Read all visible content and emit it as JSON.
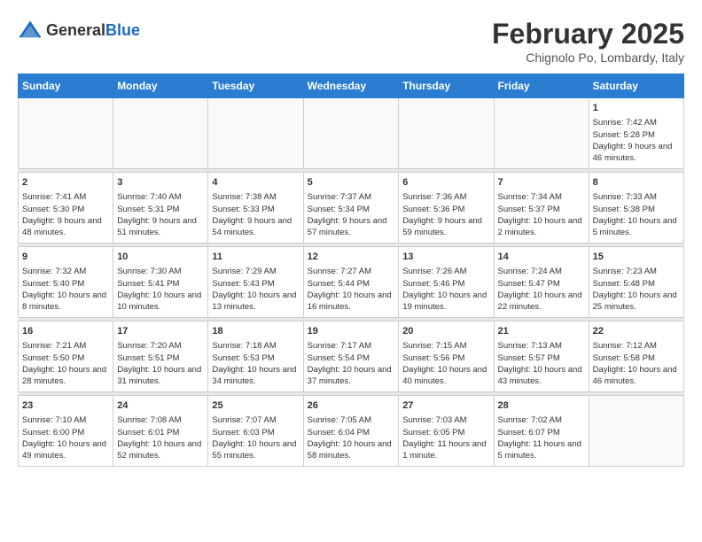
{
  "header": {
    "logo_general": "General",
    "logo_blue": "Blue",
    "title": "February 2025",
    "subtitle": "Chignolo Po, Lombardy, Italy"
  },
  "calendar": {
    "days_of_week": [
      "Sunday",
      "Monday",
      "Tuesday",
      "Wednesday",
      "Thursday",
      "Friday",
      "Saturday"
    ],
    "weeks": [
      {
        "days": [
          {
            "date": "",
            "info": ""
          },
          {
            "date": "",
            "info": ""
          },
          {
            "date": "",
            "info": ""
          },
          {
            "date": "",
            "info": ""
          },
          {
            "date": "",
            "info": ""
          },
          {
            "date": "",
            "info": ""
          },
          {
            "date": "1",
            "info": "Sunrise: 7:42 AM\nSunset: 5:28 PM\nDaylight: 9 hours and 46 minutes."
          }
        ]
      },
      {
        "days": [
          {
            "date": "2",
            "info": "Sunrise: 7:41 AM\nSunset: 5:30 PM\nDaylight: 9 hours and 48 minutes."
          },
          {
            "date": "3",
            "info": "Sunrise: 7:40 AM\nSunset: 5:31 PM\nDaylight: 9 hours and 51 minutes."
          },
          {
            "date": "4",
            "info": "Sunrise: 7:38 AM\nSunset: 5:33 PM\nDaylight: 9 hours and 54 minutes."
          },
          {
            "date": "5",
            "info": "Sunrise: 7:37 AM\nSunset: 5:34 PM\nDaylight: 9 hours and 57 minutes."
          },
          {
            "date": "6",
            "info": "Sunrise: 7:36 AM\nSunset: 5:36 PM\nDaylight: 9 hours and 59 minutes."
          },
          {
            "date": "7",
            "info": "Sunrise: 7:34 AM\nSunset: 5:37 PM\nDaylight: 10 hours and 2 minutes."
          },
          {
            "date": "8",
            "info": "Sunrise: 7:33 AM\nSunset: 5:38 PM\nDaylight: 10 hours and 5 minutes."
          }
        ]
      },
      {
        "days": [
          {
            "date": "9",
            "info": "Sunrise: 7:32 AM\nSunset: 5:40 PM\nDaylight: 10 hours and 8 minutes."
          },
          {
            "date": "10",
            "info": "Sunrise: 7:30 AM\nSunset: 5:41 PM\nDaylight: 10 hours and 10 minutes."
          },
          {
            "date": "11",
            "info": "Sunrise: 7:29 AM\nSunset: 5:43 PM\nDaylight: 10 hours and 13 minutes."
          },
          {
            "date": "12",
            "info": "Sunrise: 7:27 AM\nSunset: 5:44 PM\nDaylight: 10 hours and 16 minutes."
          },
          {
            "date": "13",
            "info": "Sunrise: 7:26 AM\nSunset: 5:46 PM\nDaylight: 10 hours and 19 minutes."
          },
          {
            "date": "14",
            "info": "Sunrise: 7:24 AM\nSunset: 5:47 PM\nDaylight: 10 hours and 22 minutes."
          },
          {
            "date": "15",
            "info": "Sunrise: 7:23 AM\nSunset: 5:48 PM\nDaylight: 10 hours and 25 minutes."
          }
        ]
      },
      {
        "days": [
          {
            "date": "16",
            "info": "Sunrise: 7:21 AM\nSunset: 5:50 PM\nDaylight: 10 hours and 28 minutes."
          },
          {
            "date": "17",
            "info": "Sunrise: 7:20 AM\nSunset: 5:51 PM\nDaylight: 10 hours and 31 minutes."
          },
          {
            "date": "18",
            "info": "Sunrise: 7:18 AM\nSunset: 5:53 PM\nDaylight: 10 hours and 34 minutes."
          },
          {
            "date": "19",
            "info": "Sunrise: 7:17 AM\nSunset: 5:54 PM\nDaylight: 10 hours and 37 minutes."
          },
          {
            "date": "20",
            "info": "Sunrise: 7:15 AM\nSunset: 5:56 PM\nDaylight: 10 hours and 40 minutes."
          },
          {
            "date": "21",
            "info": "Sunrise: 7:13 AM\nSunset: 5:57 PM\nDaylight: 10 hours and 43 minutes."
          },
          {
            "date": "22",
            "info": "Sunrise: 7:12 AM\nSunset: 5:58 PM\nDaylight: 10 hours and 46 minutes."
          }
        ]
      },
      {
        "days": [
          {
            "date": "23",
            "info": "Sunrise: 7:10 AM\nSunset: 6:00 PM\nDaylight: 10 hours and 49 minutes."
          },
          {
            "date": "24",
            "info": "Sunrise: 7:08 AM\nSunset: 6:01 PM\nDaylight: 10 hours and 52 minutes."
          },
          {
            "date": "25",
            "info": "Sunrise: 7:07 AM\nSunset: 6:03 PM\nDaylight: 10 hours and 55 minutes."
          },
          {
            "date": "26",
            "info": "Sunrise: 7:05 AM\nSunset: 6:04 PM\nDaylight: 10 hours and 58 minutes."
          },
          {
            "date": "27",
            "info": "Sunrise: 7:03 AM\nSunset: 6:05 PM\nDaylight: 11 hours and 1 minute."
          },
          {
            "date": "28",
            "info": "Sunrise: 7:02 AM\nSunset: 6:07 PM\nDaylight: 11 hours and 5 minutes."
          },
          {
            "date": "",
            "info": ""
          }
        ]
      }
    ]
  }
}
